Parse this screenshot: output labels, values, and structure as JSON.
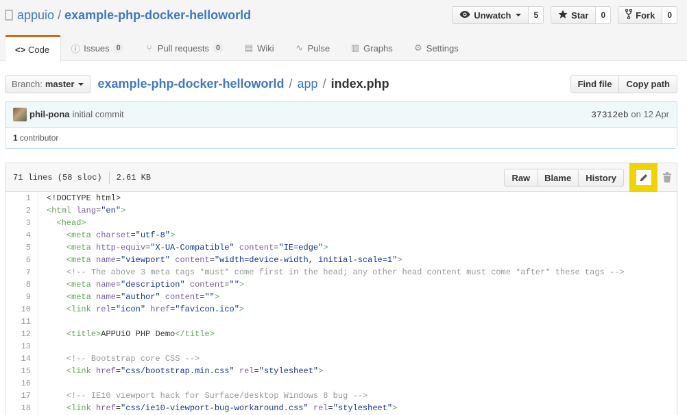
{
  "repo": {
    "owner": "appuio",
    "name": "example-php-docker-helloworld"
  },
  "actions": {
    "watch_label": "Unwatch",
    "watch_count": "5",
    "star_label": "Star",
    "star_count": "0",
    "fork_label": "Fork",
    "fork_count": "0"
  },
  "nav": {
    "code": "Code",
    "issues": "Issues",
    "issues_count": "0",
    "pulls": "Pull requests",
    "pulls_count": "0",
    "wiki": "Wiki",
    "pulse": "Pulse",
    "graphs": "Graphs",
    "settings": "Settings"
  },
  "file_nav": {
    "branch_label": "Branch:",
    "branch": "master",
    "crumb_root": "example-php-docker-helloworld",
    "crumb_dir": "app",
    "crumb_file": "index.php",
    "find_file": "Find file",
    "copy_path": "Copy path"
  },
  "commit": {
    "author": "phil-pona",
    "message": "initial commit",
    "sha": "37312eb",
    "date": "on 12 Apr",
    "contributors_count": "1",
    "contributors_label": "contributor"
  },
  "file": {
    "lines_info": "71 lines (58 sloc)",
    "size": "2.61 KB",
    "raw": "Raw",
    "blame": "Blame",
    "history": "History"
  },
  "icons": {
    "repo": "book-icon",
    "watch": "eye-icon",
    "star": "star-icon",
    "fork": "fork-icon",
    "edit": "pencil-icon",
    "delete": "trash-icon"
  },
  "colors": {
    "link": "#4078c0",
    "tab_accent": "#d26911",
    "edit_highlight": "#f1d300",
    "commit_bg": "#f1f8fa"
  },
  "code_lines": [
    [
      {
        "t": "",
        "v": "<!DOCTYPE html>"
      }
    ],
    [
      {
        "t": "tag",
        "v": "<html"
      },
      {
        "t": "",
        "v": " "
      },
      {
        "t": "attr",
        "v": "lang"
      },
      {
        "t": "",
        "v": "="
      },
      {
        "t": "str",
        "v": "\"en\""
      },
      {
        "t": "tag",
        "v": ">"
      }
    ],
    [
      {
        "t": "",
        "v": "  "
      },
      {
        "t": "tag",
        "v": "<head>"
      }
    ],
    [
      {
        "t": "",
        "v": "    "
      },
      {
        "t": "tag",
        "v": "<meta"
      },
      {
        "t": "",
        "v": " "
      },
      {
        "t": "attr",
        "v": "charset"
      },
      {
        "t": "",
        "v": "="
      },
      {
        "t": "str",
        "v": "\"utf-8\""
      },
      {
        "t": "tag",
        "v": ">"
      }
    ],
    [
      {
        "t": "",
        "v": "    "
      },
      {
        "t": "tag",
        "v": "<meta"
      },
      {
        "t": "",
        "v": " "
      },
      {
        "t": "attr",
        "v": "http-equiv"
      },
      {
        "t": "",
        "v": "="
      },
      {
        "t": "str",
        "v": "\"X-UA-Compatible\""
      },
      {
        "t": "",
        "v": " "
      },
      {
        "t": "attr",
        "v": "content"
      },
      {
        "t": "",
        "v": "="
      },
      {
        "t": "str",
        "v": "\"IE=edge\""
      },
      {
        "t": "tag",
        "v": ">"
      }
    ],
    [
      {
        "t": "",
        "v": "    "
      },
      {
        "t": "tag",
        "v": "<meta"
      },
      {
        "t": "",
        "v": " "
      },
      {
        "t": "attr",
        "v": "name"
      },
      {
        "t": "",
        "v": "="
      },
      {
        "t": "str",
        "v": "\"viewport\""
      },
      {
        "t": "",
        "v": " "
      },
      {
        "t": "attr",
        "v": "content"
      },
      {
        "t": "",
        "v": "="
      },
      {
        "t": "str",
        "v": "\"width=device-width, initial-scale=1\""
      },
      {
        "t": "tag",
        "v": ">"
      }
    ],
    [
      {
        "t": "",
        "v": "    "
      },
      {
        "t": "com",
        "v": "<!-- The above 3 meta tags *must* come first in the head; any other head content must come *after* these tags -->"
      }
    ],
    [
      {
        "t": "",
        "v": "    "
      },
      {
        "t": "tag",
        "v": "<meta"
      },
      {
        "t": "",
        "v": " "
      },
      {
        "t": "attr",
        "v": "name"
      },
      {
        "t": "",
        "v": "="
      },
      {
        "t": "str",
        "v": "\"description\""
      },
      {
        "t": "",
        "v": " "
      },
      {
        "t": "attr",
        "v": "content"
      },
      {
        "t": "",
        "v": "="
      },
      {
        "t": "str",
        "v": "\"\""
      },
      {
        "t": "tag",
        "v": ">"
      }
    ],
    [
      {
        "t": "",
        "v": "    "
      },
      {
        "t": "tag",
        "v": "<meta"
      },
      {
        "t": "",
        "v": " "
      },
      {
        "t": "attr",
        "v": "name"
      },
      {
        "t": "",
        "v": "="
      },
      {
        "t": "str",
        "v": "\"author\""
      },
      {
        "t": "",
        "v": " "
      },
      {
        "t": "attr",
        "v": "content"
      },
      {
        "t": "",
        "v": "="
      },
      {
        "t": "str",
        "v": "\"\""
      },
      {
        "t": "tag",
        "v": ">"
      }
    ],
    [
      {
        "t": "",
        "v": "    "
      },
      {
        "t": "tag",
        "v": "<link"
      },
      {
        "t": "",
        "v": " "
      },
      {
        "t": "attr",
        "v": "rel"
      },
      {
        "t": "",
        "v": "="
      },
      {
        "t": "str",
        "v": "\"icon\""
      },
      {
        "t": "",
        "v": " "
      },
      {
        "t": "attr",
        "v": "href"
      },
      {
        "t": "",
        "v": "="
      },
      {
        "t": "str",
        "v": "\"favicon.ico\""
      },
      {
        "t": "tag",
        "v": ">"
      }
    ],
    [],
    [
      {
        "t": "",
        "v": "    "
      },
      {
        "t": "tag",
        "v": "<title"
      },
      {
        "t": "tag",
        "v": ">"
      },
      {
        "t": "",
        "v": "APPUiO PHP Demo"
      },
      {
        "t": "tag",
        "v": "</title"
      },
      {
        "t": "tag",
        "v": ">"
      }
    ],
    [],
    [
      {
        "t": "",
        "v": "    "
      },
      {
        "t": "com",
        "v": "<!-- Bootstrap core CSS -->"
      }
    ],
    [
      {
        "t": "",
        "v": "    "
      },
      {
        "t": "tag",
        "v": "<link"
      },
      {
        "t": "",
        "v": " "
      },
      {
        "t": "attr",
        "v": "href"
      },
      {
        "t": "",
        "v": "="
      },
      {
        "t": "str",
        "v": "\"css/bootstrap.min.css\""
      },
      {
        "t": "",
        "v": " "
      },
      {
        "t": "attr",
        "v": "rel"
      },
      {
        "t": "",
        "v": "="
      },
      {
        "t": "str",
        "v": "\"stylesheet\""
      },
      {
        "t": "tag",
        "v": ">"
      }
    ],
    [],
    [
      {
        "t": "",
        "v": "    "
      },
      {
        "t": "com",
        "v": "<!-- IE10 viewport hack for Surface/desktop Windows 8 bug -->"
      }
    ],
    [
      {
        "t": "",
        "v": "    "
      },
      {
        "t": "tag",
        "v": "<link"
      },
      {
        "t": "",
        "v": " "
      },
      {
        "t": "attr",
        "v": "href"
      },
      {
        "t": "",
        "v": "="
      },
      {
        "t": "str",
        "v": "\"css/ie10-viewport-bug-workaround.css\""
      },
      {
        "t": "",
        "v": " "
      },
      {
        "t": "attr",
        "v": "rel"
      },
      {
        "t": "",
        "v": "="
      },
      {
        "t": "str",
        "v": "\"stylesheet\""
      },
      {
        "t": "tag",
        "v": ">"
      }
    ]
  ]
}
